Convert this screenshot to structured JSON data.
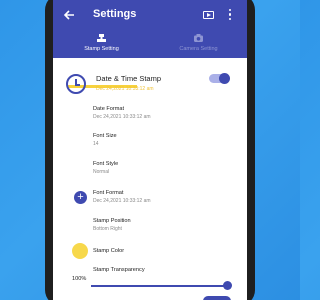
{
  "appbar": {
    "title": "Settings"
  },
  "tabs": [
    {
      "label": "Stamp Setting"
    },
    {
      "label": "Camera Setting"
    }
  ],
  "main": {
    "title": "Date & Time Stamp",
    "subtitle": "Dec 24,2021 10:33:12 am"
  },
  "settings": [
    {
      "label": "Date Format",
      "value": "Dec 24,2021 10:33:12 am"
    },
    {
      "label": "Font Size",
      "value": "14"
    },
    {
      "label": "Font Style",
      "value": "Normal"
    },
    {
      "label": "Font Format",
      "value": "Dec 24,2021 10:33:12 am"
    },
    {
      "label": "Stamp Position",
      "value": "Bottom Right"
    },
    {
      "label": "Stamp Color"
    },
    {
      "label": "Stamp Transparency",
      "value": "100%"
    }
  ],
  "colors": {
    "primary": "#3f4ab0",
    "accent": "#f7d23d",
    "stamp_color": "#f7d84b"
  },
  "icons": [
    "back-arrow-icon",
    "video-icon",
    "more-vert-icon",
    "stamp-icon",
    "camera-icon",
    "clock-icon",
    "add-icon"
  ]
}
